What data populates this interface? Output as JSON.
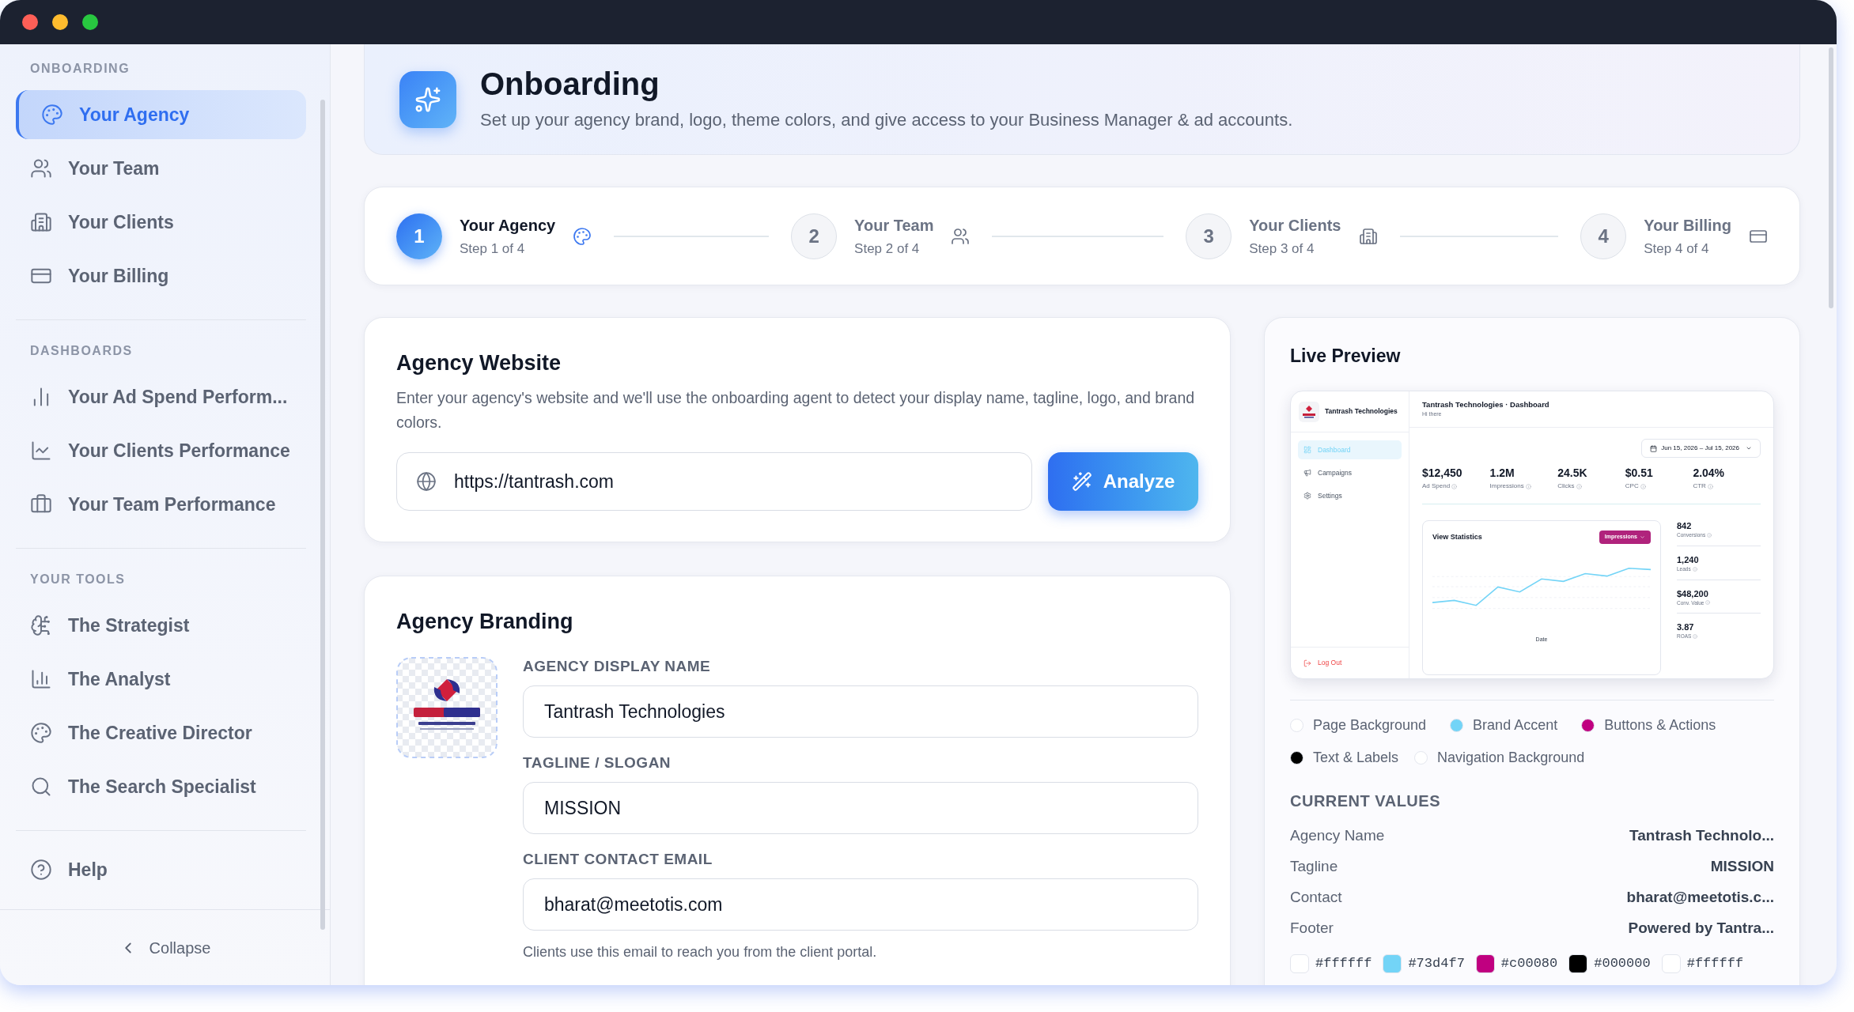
{
  "sidebar": {
    "sections": [
      {
        "heading": "ONBOARDING",
        "items": [
          {
            "label": "Your Agency",
            "selected": true
          },
          {
            "label": "Your Team",
            "selected": false
          },
          {
            "label": "Your Clients",
            "selected": false
          },
          {
            "label": "Your Billing",
            "selected": false
          }
        ]
      },
      {
        "heading": "DASHBOARDS",
        "items": [
          {
            "label": "Your Ad Spend Perform...",
            "selected": false
          },
          {
            "label": "Your Clients Performance",
            "selected": false
          },
          {
            "label": "Your Team Performance",
            "selected": false
          }
        ]
      },
      {
        "heading": "YOUR TOOLS",
        "items": [
          {
            "label": "The Strategist",
            "selected": false
          },
          {
            "label": "The Analyst",
            "selected": false
          },
          {
            "label": "The Creative Director",
            "selected": false
          },
          {
            "label": "The Search Specialist",
            "selected": false
          }
        ]
      }
    ],
    "help": "Help",
    "collapse": "Collapse"
  },
  "header": {
    "title": "Onboarding",
    "subtitle": "Set up your agency brand, logo, theme colors, and give access to your Business Manager & ad accounts."
  },
  "stepper": [
    {
      "number": "1",
      "title": "Your Agency",
      "subtitle": "Step 1 of 4",
      "selected": true
    },
    {
      "number": "2",
      "title": "Your Team",
      "subtitle": "Step 2 of 4",
      "selected": false
    },
    {
      "number": "3",
      "title": "Your Clients",
      "subtitle": "Step 3 of 4",
      "selected": false
    },
    {
      "number": "4",
      "title": "Your Billing",
      "subtitle": "Step 4 of 4",
      "selected": false
    }
  ],
  "website_card": {
    "title": "Agency Website",
    "description": "Enter your agency's website and we'll use the onboarding agent to detect your display name, tagline, logo, and brand colors.",
    "url_field": {
      "value": "https://tantrash.com"
    },
    "analyze_button": "Analyze"
  },
  "branding_card": {
    "title": "Agency Branding",
    "fields": [
      {
        "label": "AGENCY DISPLAY NAME",
        "value": "Tantrash Technologies"
      },
      {
        "label": "TAGLINE / SLOGAN",
        "value": "MISSION"
      },
      {
        "label": "CLIENT CONTACT EMAIL",
        "value": "bharat@meetotis.com"
      }
    ],
    "helper": "Clients use this email to reach you from the client portal."
  },
  "live_preview": {
    "title": "Live Preview",
    "preview": {
      "brand": "Tantrash Technologies",
      "nav": [
        {
          "label": "Dashboard",
          "selected": true
        },
        {
          "label": "Campaigns",
          "selected": false
        },
        {
          "label": "Settings",
          "selected": false
        }
      ],
      "logout": "Log Out",
      "title": "Tantrash Technologies · Dashboard",
      "greeting": "Hi there",
      "date_range": "Jun 15, 2026 – Jul 15, 2026",
      "stats": [
        {
          "value": "$12,450",
          "label": "Ad Spend"
        },
        {
          "value": "1.2M",
          "label": "Impressions"
        },
        {
          "value": "24.5K",
          "label": "Clicks"
        },
        {
          "value": "$0.51",
          "label": "CPC"
        },
        {
          "value": "2.04%",
          "label": "CTR"
        }
      ],
      "chart_title": "View Statistics",
      "metric_button": "Impressions",
      "x_axis_label": "Date",
      "side_stats": [
        {
          "value": "842",
          "label": "Conversions"
        },
        {
          "value": "1,240",
          "label": "Leads"
        },
        {
          "value": "$48,200",
          "label": "Conv. Value"
        },
        {
          "value": "3.87",
          "label": "ROAS"
        }
      ]
    },
    "legend": [
      {
        "label": "Page Background",
        "color": "#ffffff"
      },
      {
        "label": "Brand Accent",
        "color": "#73d4f7"
      },
      {
        "label": "Buttons & Actions",
        "color": "#c00080"
      },
      {
        "label": "Text & Labels",
        "color": "#000000"
      },
      {
        "label": "Navigation Background",
        "color": "#ffffff"
      }
    ],
    "current_values_heading": "CURRENT VALUES",
    "current_values": [
      {
        "label": "Agency Name",
        "value": "Tantrash Technolo..."
      },
      {
        "label": "Tagline",
        "value": "MISSION"
      },
      {
        "label": "Contact",
        "value": "bharat@meetotis.c..."
      },
      {
        "label": "Footer",
        "value": "Powered by Tantra..."
      }
    ],
    "swatches": [
      {
        "label": "#ffffff",
        "color": "#ffffff"
      },
      {
        "label": "#73d4f7",
        "color": "#73d4f7"
      },
      {
        "label": "#c00080",
        "color": "#c00080"
      },
      {
        "label": "#000000",
        "color": "#000000"
      },
      {
        "label": "#ffffff",
        "color": "#ffffff"
      }
    ]
  }
}
